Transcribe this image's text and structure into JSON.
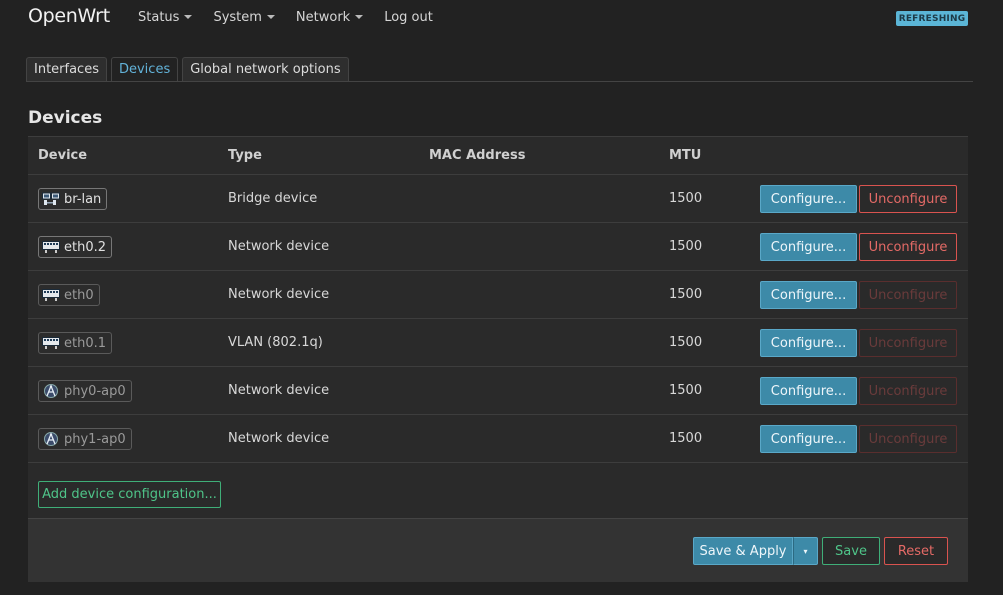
{
  "header": {
    "brand": "OpenWrt",
    "nav": [
      {
        "label": "Status",
        "has_caret": true
      },
      {
        "label": "System",
        "has_caret": true
      },
      {
        "label": "Network",
        "has_caret": true
      },
      {
        "label": "Log out",
        "has_caret": false
      }
    ],
    "badge": "REFRESHING"
  },
  "tabs": [
    {
      "label": "Interfaces",
      "active": false
    },
    {
      "label": "Devices",
      "active": true
    },
    {
      "label": "Global network options",
      "active": false
    }
  ],
  "section_title": "Devices",
  "table": {
    "columns": {
      "device": "Device",
      "type": "Type",
      "mac": "MAC Address",
      "mtu": "MTU"
    },
    "rows": [
      {
        "device": "br-lan",
        "icon": "bridge-icon",
        "dim": false,
        "type": "Bridge device",
        "mac": "",
        "mtu": "1500",
        "configure": "Configure...",
        "unconfigure": "Unconfigure",
        "unconfigure_enabled": true
      },
      {
        "device": "eth0.2",
        "icon": "ethernet-icon",
        "dim": false,
        "type": "Network device",
        "mac": "",
        "mtu": "1500",
        "configure": "Configure...",
        "unconfigure": "Unconfigure",
        "unconfigure_enabled": true
      },
      {
        "device": "eth0",
        "icon": "ethernet-icon",
        "dim": true,
        "type": "Network device",
        "mac": "",
        "mtu": "1500",
        "configure": "Configure...",
        "unconfigure": "Unconfigure",
        "unconfigure_enabled": false
      },
      {
        "device": "eth0.1",
        "icon": "ethernet-icon",
        "dim": true,
        "type": "VLAN (802.1q)",
        "mac": "",
        "mtu": "1500",
        "configure": "Configure...",
        "unconfigure": "Unconfigure",
        "unconfigure_enabled": false
      },
      {
        "device": "phy0-ap0",
        "icon": "wifi-icon",
        "dim": true,
        "type": "Network device",
        "mac": "",
        "mtu": "1500",
        "configure": "Configure...",
        "unconfigure": "Unconfigure",
        "unconfigure_enabled": false
      },
      {
        "device": "phy1-ap0",
        "icon": "wifi-icon",
        "dim": true,
        "type": "Network device",
        "mac": "",
        "mtu": "1500",
        "configure": "Configure...",
        "unconfigure": "Unconfigure",
        "unconfigure_enabled": false
      }
    ]
  },
  "add_button": "Add device configuration...",
  "footer": {
    "save_apply": "Save & Apply",
    "dropdown_glyph": "▾",
    "save": "Save",
    "reset": "Reset"
  },
  "colors": {
    "accent": "#3d8aa8",
    "positive": "#4fc489",
    "negative": "#e46a66",
    "background": "#222222"
  }
}
